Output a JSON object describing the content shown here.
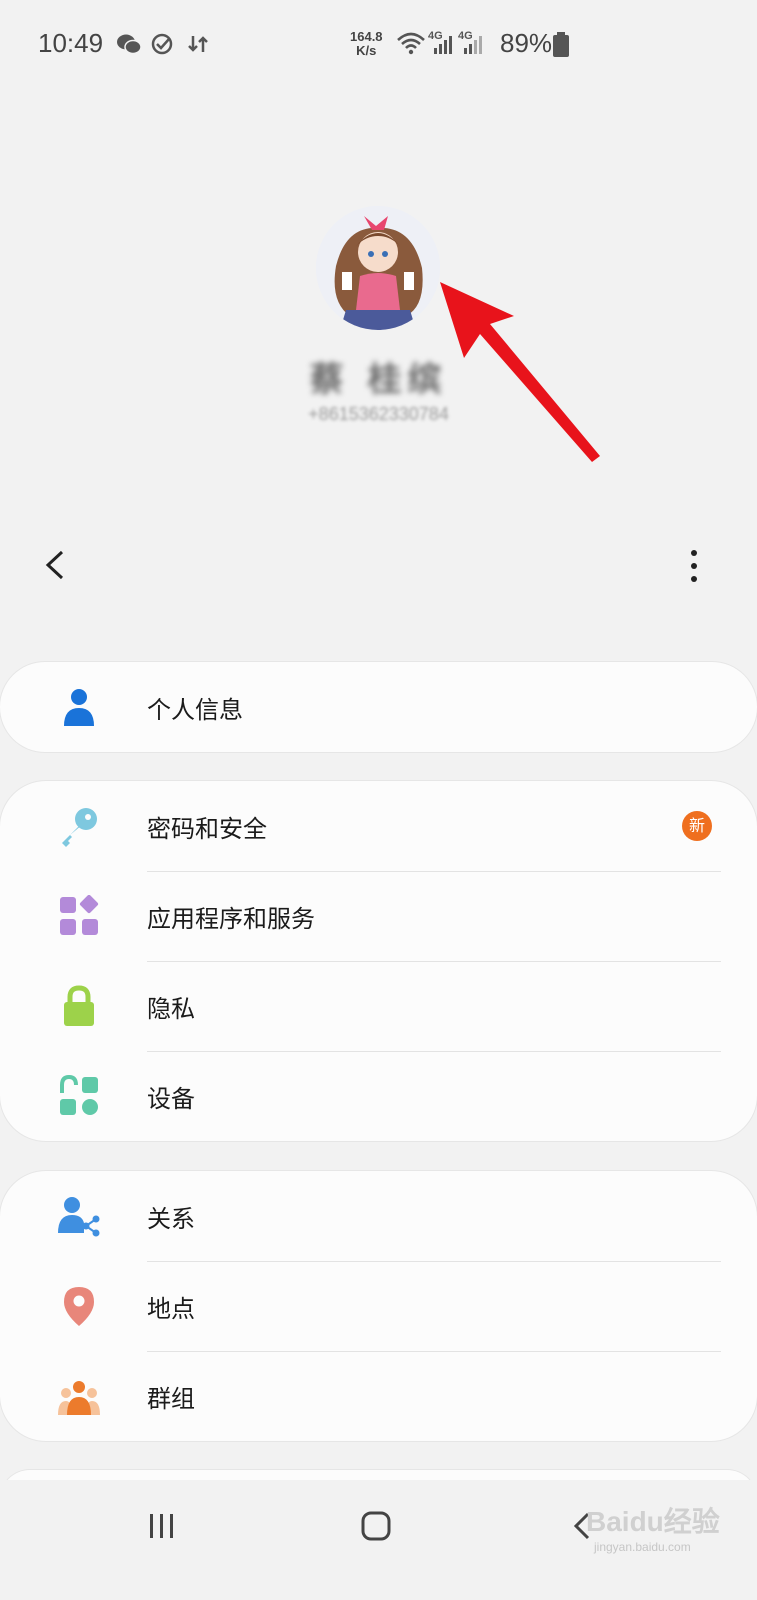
{
  "status_bar": {
    "time": "10:49",
    "speed_value": "164.8",
    "speed_unit": "K/s",
    "network_1": "4G",
    "network_2": "4G",
    "battery": "89%"
  },
  "profile": {
    "name": "蔡 桂缤",
    "phone": "+8615362330784"
  },
  "header": {
    "back_icon": "chevron-left-icon",
    "more_icon": "more-vertical-icon"
  },
  "sections": [
    {
      "items": [
        {
          "label": "个人信息",
          "icon": "person-icon",
          "color": "#1a73d9"
        }
      ]
    },
    {
      "items": [
        {
          "label": "密码和安全",
          "icon": "key-icon",
          "color": "#7ec8df",
          "badge": "新"
        },
        {
          "label": "应用程序和服务",
          "icon": "apps-icon",
          "color": "#b38ad9"
        },
        {
          "label": "隐私",
          "icon": "lock-icon",
          "color": "#9dd24a"
        },
        {
          "label": "设备",
          "icon": "devices-icon",
          "color": "#5fc9a8"
        }
      ]
    },
    {
      "items": [
        {
          "label": "关系",
          "icon": "person-share-icon",
          "color": "#3f8fe0"
        },
        {
          "label": "地点",
          "icon": "location-pin-icon",
          "color": "#e8867a"
        },
        {
          "label": "群组",
          "icon": "group-icon",
          "color": "#ec7b2c"
        }
      ]
    }
  ],
  "watermark": {
    "brand": "Baidu经验",
    "url": "jingyan.baidu.com"
  },
  "colors": {
    "background": "#f2f2f2",
    "card": "#fcfcfc",
    "badge": "#ef6f1f",
    "arrow": "#e8131b"
  }
}
